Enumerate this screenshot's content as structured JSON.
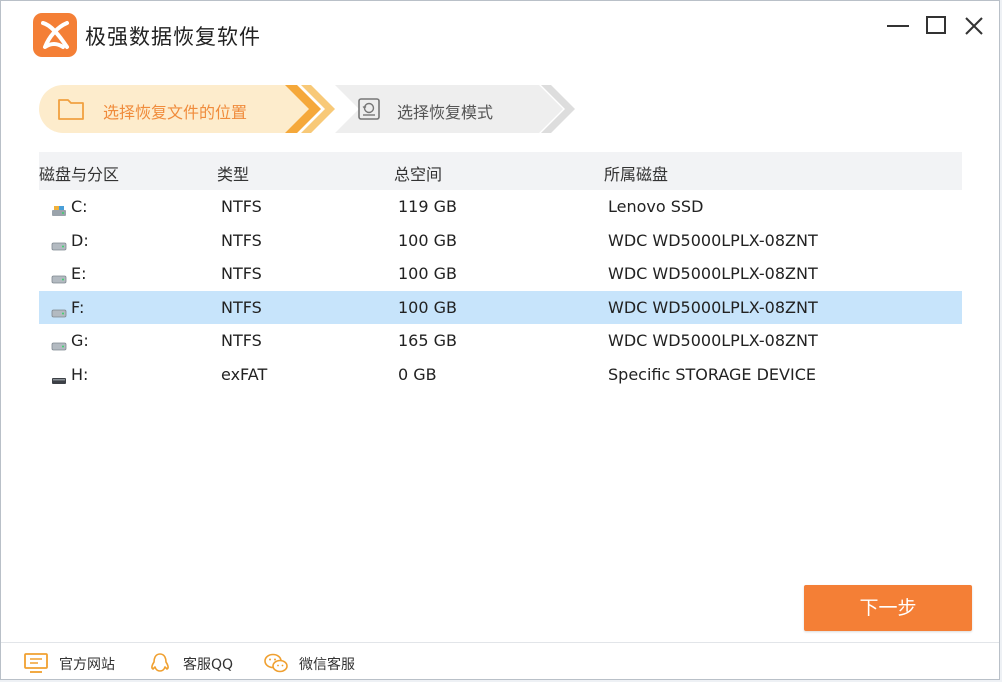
{
  "app": {
    "title": "极强数据恢复软件"
  },
  "steps": [
    {
      "label": "选择恢复文件的位置",
      "active": true
    },
    {
      "label": "选择恢复模式",
      "active": false
    }
  ],
  "table": {
    "headers": [
      "磁盘与分区",
      "类型",
      "总空间",
      "所属磁盘"
    ],
    "rows": [
      {
        "partition": "C:",
        "type": "NTFS",
        "size": "119 GB",
        "disk": "Lenovo SSD",
        "icon": "system-drive-icon",
        "selected": false
      },
      {
        "partition": "D:",
        "type": "NTFS",
        "size": "100 GB",
        "disk": "WDC WD5000LPLX-08ZNT",
        "icon": "hard-drive-icon",
        "selected": false
      },
      {
        "partition": "E:",
        "type": "NTFS",
        "size": "100 GB",
        "disk": "WDC WD5000LPLX-08ZNT",
        "icon": "hard-drive-icon",
        "selected": false
      },
      {
        "partition": "F:",
        "type": "NTFS",
        "size": "100 GB",
        "disk": "WDC WD5000LPLX-08ZNT",
        "icon": "hard-drive-icon",
        "selected": true
      },
      {
        "partition": "G:",
        "type": "NTFS",
        "size": "165 GB",
        "disk": "WDC WD5000LPLX-08ZNT",
        "icon": "hard-drive-icon",
        "selected": false
      },
      {
        "partition": "H:",
        "type": "exFAT",
        "size": "0 GB",
        "disk": "Specific STORAGE DEVICE",
        "icon": "removable-drive-icon",
        "selected": false
      }
    ]
  },
  "buttons": {
    "next": "下一步"
  },
  "footer": {
    "website": "官方网站",
    "qq": "客服QQ",
    "wechat": "微信客服"
  },
  "colors": {
    "accent": "#f47f36",
    "step_active_bg": "#fdeccc",
    "selected_row": "#c7e4fb"
  }
}
